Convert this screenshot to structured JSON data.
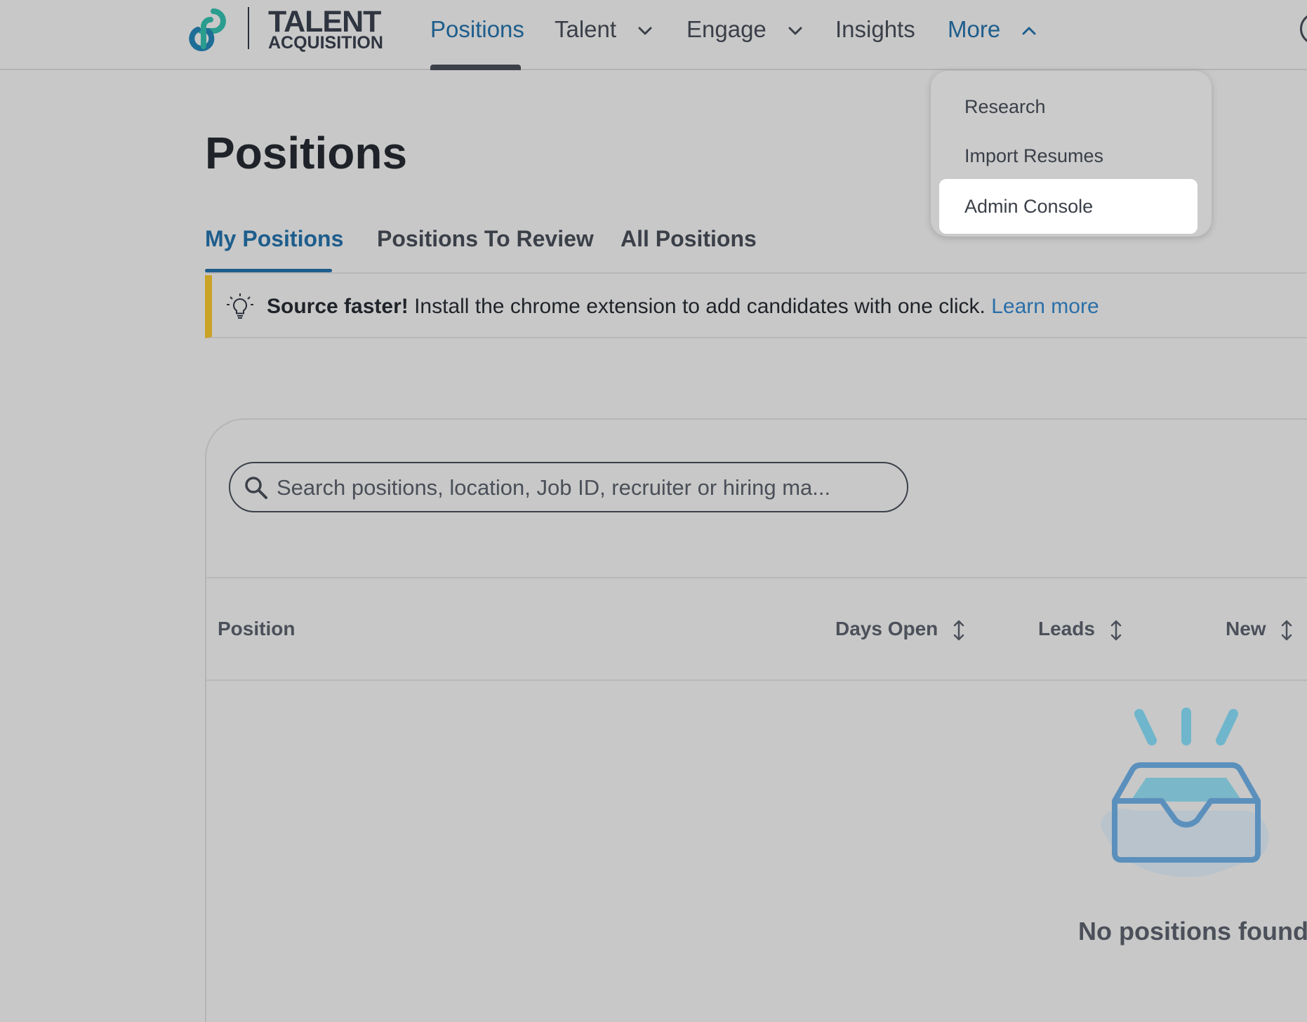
{
  "brand": {
    "name_line1": "TALENT",
    "name_line2": "ACQUISITION",
    "accent_color": "#1d5d8c",
    "logo_icon": "infinity-loop-icon"
  },
  "nav": {
    "items": [
      {
        "label": "Positions",
        "active": true
      },
      {
        "label": "Talent",
        "has_dropdown": true
      },
      {
        "label": "Engage",
        "has_dropdown": true
      },
      {
        "label": "Insights"
      },
      {
        "label": "More",
        "has_dropdown": true,
        "expanded": true
      }
    ]
  },
  "more_menu": {
    "items": [
      {
        "label": "Research"
      },
      {
        "label": "Import Resumes"
      },
      {
        "label": "Admin Console",
        "highlighted": true
      }
    ]
  },
  "page": {
    "title": "Positions",
    "tabs": [
      {
        "label": "My Positions",
        "active": true
      },
      {
        "label": "Positions To Review"
      },
      {
        "label": "All Positions"
      }
    ]
  },
  "banner": {
    "icon": "lightbulb-icon",
    "bold_text": "Source faster!",
    "text": " Install the chrome extension to add candidates with one click. ",
    "link_text": "Learn more",
    "accent_color": "#c9a227"
  },
  "table": {
    "search_placeholder": "Search positions, location, Job ID, recruiter or hiring ma...",
    "search_value": "",
    "columns": [
      {
        "label": "Position",
        "sortable": false
      },
      {
        "label": "Days Open",
        "sortable": true
      },
      {
        "label": "Leads",
        "sortable": true
      },
      {
        "label": "New",
        "sortable": true
      }
    ],
    "rows": [],
    "empty_icon": "empty-inbox-icon",
    "empty_message": "No positions found"
  }
}
